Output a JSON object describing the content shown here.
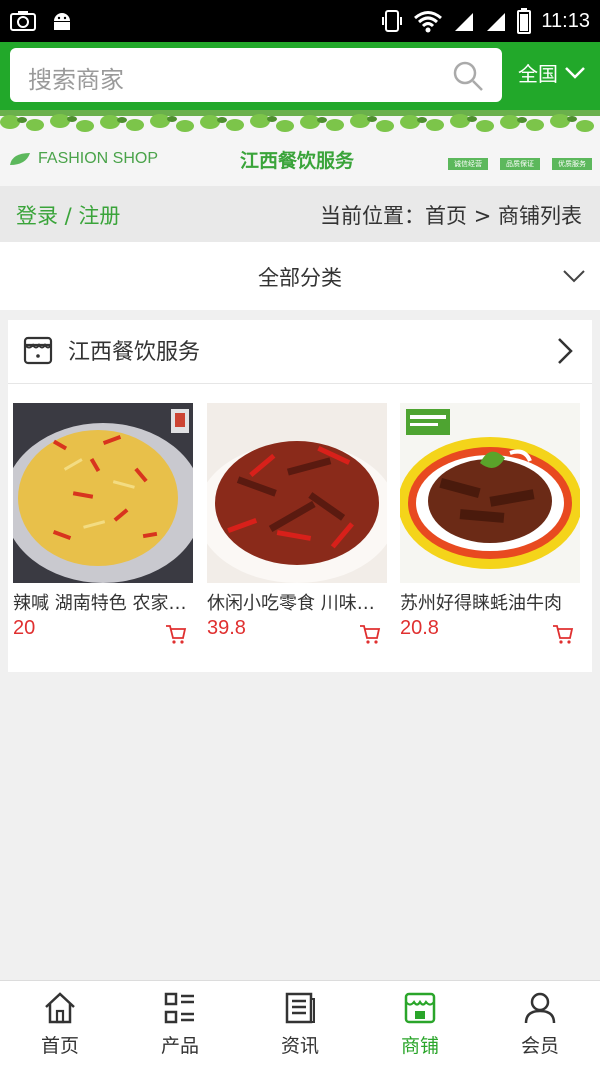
{
  "status_bar": {
    "time": "11:13"
  },
  "header": {
    "search_placeholder": "搜索商家",
    "region": "全国"
  },
  "banner": {
    "brand": "FASHION SHOP",
    "title": "江西餐饮服务",
    "tags": [
      "诚信经营",
      "品质保证",
      "优质服务"
    ]
  },
  "breadcrumb": {
    "login": "登录 / 注册",
    "location": "当前位置：首页 > 商铺列表"
  },
  "category": {
    "label": "全部分类"
  },
  "shop": {
    "name": "江西餐饮服务",
    "products": [
      {
        "name": "辣喊 湖南特色 农家自制",
        "price": "20"
      },
      {
        "name": "休闲小吃零食 川味牛肉",
        "price": "39.8"
      },
      {
        "name": "苏州好得睐蚝油牛肉",
        "price": "20.8"
      }
    ]
  },
  "bottom_nav": [
    {
      "label": "首页"
    },
    {
      "label": "产品"
    },
    {
      "label": "资讯"
    },
    {
      "label": "商铺"
    },
    {
      "label": "会员"
    }
  ],
  "colors": {
    "accent": "#22a82a",
    "price": "#e03030"
  }
}
